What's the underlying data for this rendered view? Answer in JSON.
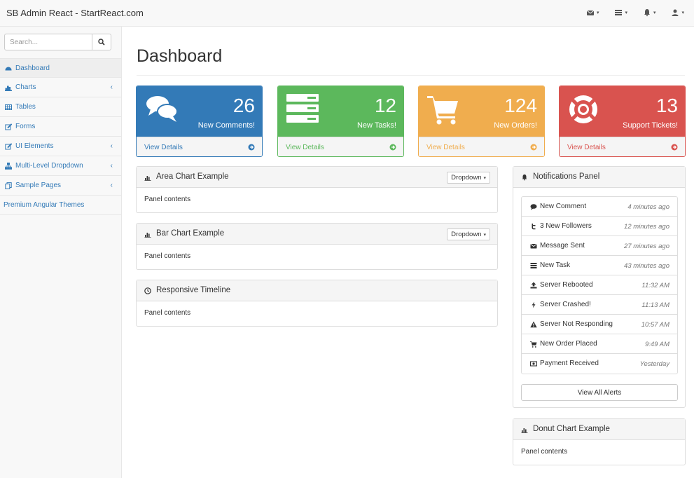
{
  "app": {
    "title": "SB Admin React - StartReact.com"
  },
  "topbar": {
    "icons": [
      "envelope-icon",
      "tasks-icon",
      "bell-icon",
      "user-icon"
    ]
  },
  "search": {
    "placeholder": "Search..."
  },
  "sidebar": {
    "items": [
      {
        "label": "Dashboard",
        "icon": "dashboard-icon",
        "active": true,
        "has_arrow": false
      },
      {
        "label": "Charts",
        "icon": "bar-chart-icon",
        "has_arrow": true,
        "arrow": "‹"
      },
      {
        "label": "Tables",
        "icon": "table-icon",
        "has_arrow": false
      },
      {
        "label": "Forms",
        "icon": "edit-icon",
        "has_arrow": false
      },
      {
        "label": "UI Elements",
        "icon": "edit-icon",
        "has_arrow": true,
        "arrow": "‹"
      },
      {
        "label": "Multi-Level Dropdown",
        "icon": "sitemap-icon",
        "has_arrow": true,
        "arrow": "‹"
      },
      {
        "label": "Sample Pages",
        "icon": "files-icon",
        "has_arrow": true,
        "arrow": "‹"
      },
      {
        "label": "Premium Angular Themes",
        "has_arrow": false
      }
    ]
  },
  "main": {
    "title": "Dashboard",
    "stats": [
      {
        "count": "26",
        "label": "New Comments!",
        "link": "View Details",
        "color": "#337ab7",
        "icon": "comments-icon"
      },
      {
        "count": "12",
        "label": "New Tasks!",
        "link": "View Details",
        "color": "#5cb85c",
        "icon": "tasks-icon"
      },
      {
        "count": "124",
        "label": "New Orders!",
        "link": "View Details",
        "color": "#f0ad4e",
        "icon": "shopping-cart-icon"
      },
      {
        "count": "13",
        "label": "Support Tickets!",
        "link": "View Details",
        "color": "#d9534f",
        "icon": "support-icon"
      }
    ],
    "panels": {
      "area": {
        "title": "Area Chart Example",
        "dropdown": "Dropdown",
        "body": "Panel contents"
      },
      "bar": {
        "title": "Bar Chart Example",
        "dropdown": "Dropdown",
        "body": "Panel contents"
      },
      "timeline": {
        "title": "Responsive Timeline",
        "body": "Panel contents"
      },
      "donut": {
        "title": "Donut Chart Example",
        "body": "Panel contents"
      }
    },
    "notifications": {
      "title": "Notifications Panel",
      "items": [
        {
          "label": "New Comment",
          "time": "4 minutes ago",
          "icon": "comment-icon"
        },
        {
          "label": "3 New Followers",
          "time": "12 minutes ago",
          "icon": "twitter-icon"
        },
        {
          "label": "Message Sent",
          "time": "27 minutes ago",
          "icon": "envelope-icon"
        },
        {
          "label": "New Task",
          "time": "43 minutes ago",
          "icon": "tasks-icon"
        },
        {
          "label": "Server Rebooted",
          "time": "11:32 AM",
          "icon": "upload-icon"
        },
        {
          "label": "Server Crashed!",
          "time": "11:13 AM",
          "icon": "bolt-icon"
        },
        {
          "label": "Server Not Responding",
          "time": "10:57 AM",
          "icon": "warning-icon"
        },
        {
          "label": "New Order Placed",
          "time": "9:49 AM",
          "icon": "shopping-cart-icon"
        },
        {
          "label": "Payment Received",
          "time": "Yesterday",
          "icon": "money-icon"
        }
      ],
      "view_all": "View All Alerts"
    }
  }
}
